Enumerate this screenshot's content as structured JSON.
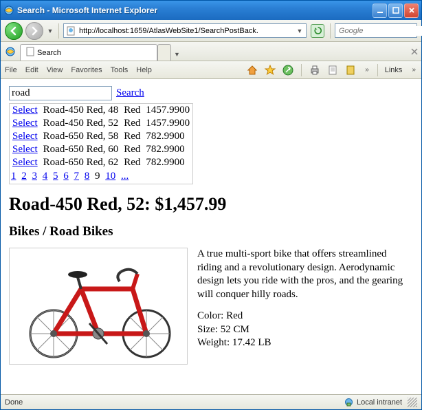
{
  "window": {
    "title": "Search - Microsoft Internet Explorer"
  },
  "nav": {
    "url": "http://localhost:1659/AtlasWebSite1/SearchPostBack.",
    "search_placeholder": "Google"
  },
  "tab": {
    "title": "Search"
  },
  "menu": {
    "file": "File",
    "edit": "Edit",
    "view": "View",
    "favorites": "Favorites",
    "tools": "Tools",
    "help": "Help",
    "links": "Links"
  },
  "page": {
    "search_value": "road",
    "search_link": "Search",
    "select_label": "Select",
    "results": [
      {
        "name": "Road-450 Red, 48",
        "color": "Red",
        "price": "1457.9900"
      },
      {
        "name": "Road-450 Red, 52",
        "color": "Red",
        "price": "1457.9900"
      },
      {
        "name": "Road-650 Red, 58",
        "color": "Red",
        "price": "782.9900"
      },
      {
        "name": "Road-650 Red, 60",
        "color": "Red",
        "price": "782.9900"
      },
      {
        "name": "Road-650 Red, 62",
        "color": "Red",
        "price": "782.9900"
      }
    ],
    "pager": [
      "1",
      "2",
      "3",
      "4",
      "5",
      "6",
      "7",
      "8",
      "9",
      "10",
      "..."
    ],
    "pager_current": "9",
    "product_heading": "Road-450 Red, 52: $1,457.99",
    "category_heading": "Bikes / Road Bikes",
    "description": "A true multi-sport bike that offers streamlined riding and a revolutionary design. Aerodynamic design lets you ride with the pros, and the gearing will conquer hilly roads.",
    "color_line": "Color: Red",
    "size_line": "Size: 52 CM",
    "weight_line": "Weight: 17.42 LB"
  },
  "status": {
    "left": "Done",
    "zone": "Local intranet"
  }
}
